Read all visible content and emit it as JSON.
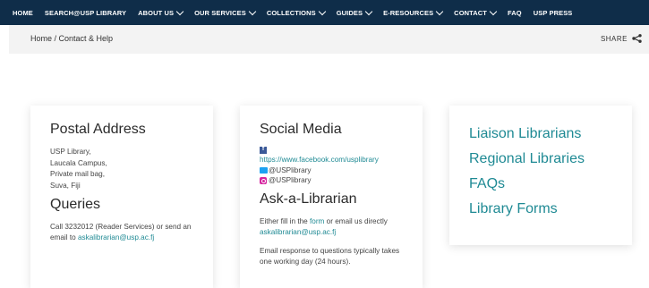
{
  "nav": {
    "items": [
      {
        "label": "HOME",
        "dropdown": false
      },
      {
        "label": "SEARCH@USP LIBRARY",
        "dropdown": false
      },
      {
        "label": "ABOUT US",
        "dropdown": true
      },
      {
        "label": "OUR SERVICES",
        "dropdown": true
      },
      {
        "label": "COLLECTIONS",
        "dropdown": true
      },
      {
        "label": "GUIDES",
        "dropdown": true
      },
      {
        "label": "E-RESOURCES",
        "dropdown": true
      },
      {
        "label": "CONTACT",
        "dropdown": true
      },
      {
        "label": "FAQ",
        "dropdown": false
      },
      {
        "label": "USP PRESS",
        "dropdown": false
      }
    ]
  },
  "breadcrumb": "Home / Contact & Help",
  "share_label": "SHARE",
  "postal": {
    "title": "Postal Address",
    "lines": [
      "USP Library,",
      "Laucala Campus,",
      "Private mail bag,",
      "Suva, Fiji"
    ],
    "queries_title": "Queries",
    "queries_text": "Call 3232012 (Reader Services) or send an email to ",
    "queries_email": "askalibrarian@usp.ac.fj"
  },
  "social": {
    "title": "Social Media",
    "facebook_url": "https://www.facebook.com/usplibrary",
    "twitter": "@USPlibrary",
    "instagram": "@USPlibrary",
    "ask_title": "Ask-a-Librarian",
    "ask_text_1": "Either fill in the ",
    "ask_form_link": "form",
    "ask_text_2": " or email us directly ",
    "ask_email": "askalibrarian@usp.ac.fj",
    "ask_note": "Email response to questions typically takes one working day (24 hours)."
  },
  "quick_links": [
    "Liaison Librarians",
    "Regional Libraries",
    "FAQs",
    "Library Forms"
  ],
  "colors": {
    "nav_bg": "#0f2d49",
    "link": "#1f8a94",
    "breadcrumb_bg": "#f3f3f3"
  }
}
